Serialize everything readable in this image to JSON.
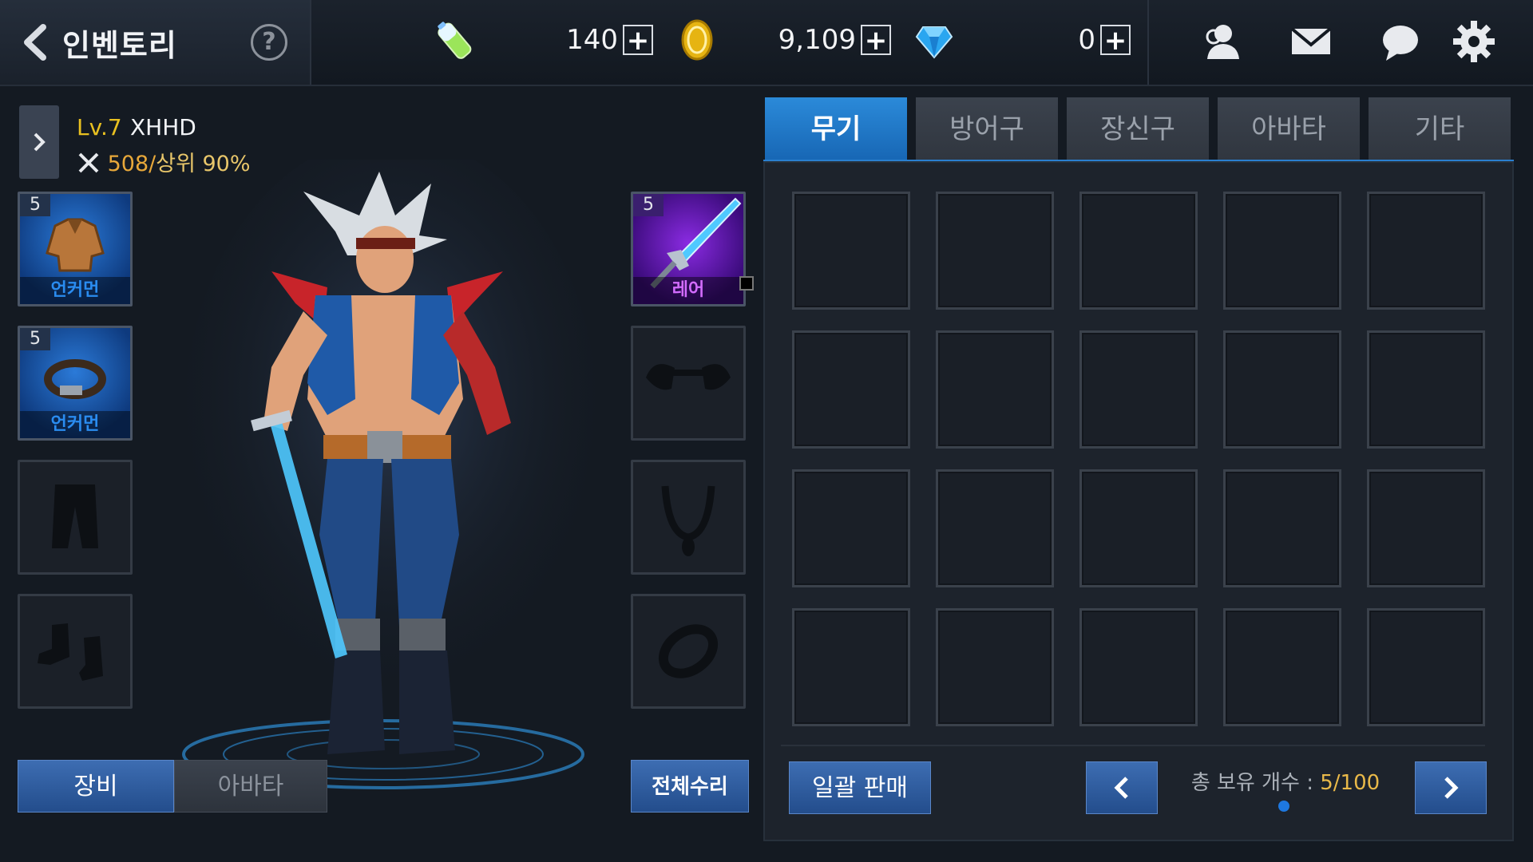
{
  "header": {
    "title": "인벤토리",
    "help_label": "?",
    "currencies": [
      {
        "name": "stamina",
        "icon": "energy-battery-icon",
        "value": "140",
        "plus": "+"
      },
      {
        "name": "gold",
        "icon": "gold-coin-icon",
        "value": "9,109",
        "plus": "+"
      },
      {
        "name": "gem",
        "icon": "diamond-gem-icon",
        "value": "0",
        "plus": "+"
      }
    ],
    "right_icons": [
      "friends-icon",
      "mail-icon",
      "chat-icon",
      "settings-gear-icon"
    ]
  },
  "character": {
    "level": "Lv.7",
    "name": "XHHD",
    "power": "508/",
    "rank": "상위 90%"
  },
  "equipment": {
    "left": [
      {
        "slot": "top",
        "level": "5",
        "grade": "언커먼",
        "grade_color": "#2a8cf0"
      },
      {
        "slot": "belt",
        "level": "5",
        "grade": "언커먼",
        "grade_color": "#2a8cf0"
      },
      {
        "slot": "pants",
        "level": "",
        "grade": ""
      },
      {
        "slot": "shoes",
        "level": "",
        "grade": ""
      }
    ],
    "right": [
      {
        "slot": "weapon",
        "level": "5",
        "grade": "레어",
        "grade_color": "#d36cff"
      },
      {
        "slot": "shoulder",
        "level": "",
        "grade": ""
      },
      {
        "slot": "necklace",
        "level": "",
        "grade": ""
      },
      {
        "slot": "ring",
        "level": "",
        "grade": ""
      }
    ]
  },
  "bottom_left": {
    "equip_tab": "장비",
    "avatar_tab": "아바타",
    "repair_all": "전체수리"
  },
  "inventory": {
    "tabs": [
      "무기",
      "방어구",
      "장신구",
      "아바타",
      "기타"
    ],
    "active_tab": "무기",
    "sell_all": "일괄 판매",
    "count_label": "총 보유 개수 : ",
    "count_value": "5/100"
  },
  "colors": {
    "accent_blue": "#1e78e0",
    "uncommon": "#2a8cf0",
    "rare": "#d36cff",
    "level_yellow": "#e8c020"
  }
}
